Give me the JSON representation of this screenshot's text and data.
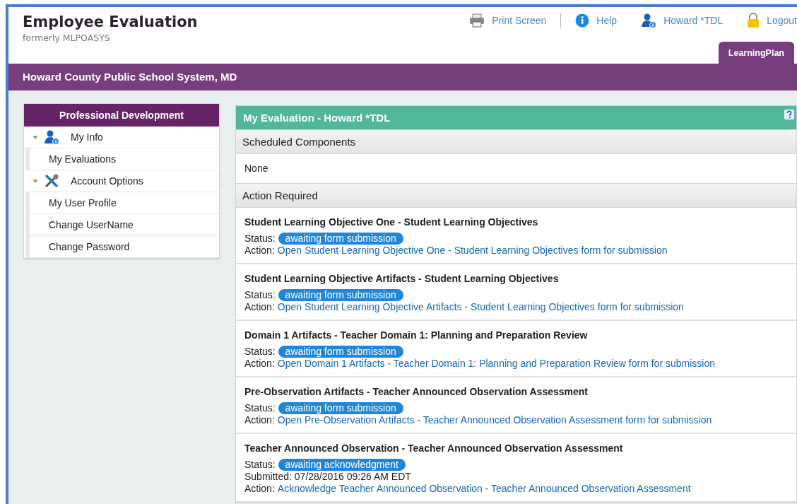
{
  "header": {
    "title": "Employee Evaluation",
    "subtitle": "formerly MLPOASYS"
  },
  "nav": [
    {
      "kind": "print",
      "label": "Print Screen"
    },
    {
      "kind": "help",
      "label": "Help"
    },
    {
      "kind": "user",
      "label": "Howard *TDL"
    },
    {
      "kind": "logout",
      "label": "Logout"
    }
  ],
  "tabs": [
    {
      "label": "LearningPlan",
      "selected": true
    }
  ],
  "org_bar": "Howard County Public School System, MD",
  "sidebar": {
    "title": "Professional Development",
    "groups": [
      {
        "kind": "user",
        "label": "My Info",
        "expanded": true,
        "children": [
          {
            "label": "My Evaluations"
          }
        ]
      },
      {
        "kind": "tools",
        "label": "Account Options",
        "expanded": true,
        "children": [
          {
            "label": "My User Profile"
          },
          {
            "label": "Change UserName"
          },
          {
            "label": "Change Password"
          }
        ]
      }
    ]
  },
  "panel": {
    "title": "My Evaluation - Howard *TDL",
    "sections": [
      {
        "heading": "Scheduled Components",
        "empty_text": "None"
      },
      {
        "heading": "Action Required",
        "items": [
          {
            "title": "Student Learning Objective One - Student Learning Objectives",
            "status_label": "Status:",
            "status": "awaiting form submission",
            "action_label": "Action:",
            "action": "Open Student Learning Objective One - Student Learning Objectives form for submission"
          },
          {
            "title": "Student Learning Objective Artifacts - Student Learning Objectives",
            "status_label": "Status:",
            "status": "awaiting form submission",
            "action_label": "Action:",
            "action": "Open Student Learning Objective Artifacts - Student Learning Objectives form for submission"
          },
          {
            "title": "Domain 1 Artifacts - Teacher Domain 1: Planning and Preparation Review",
            "status_label": "Status:",
            "status": "awaiting form submission",
            "action_label": "Action:",
            "action": "Open Domain 1 Artifacts - Teacher Domain 1: Planning and Preparation Review form for submission"
          },
          {
            "title": "Pre-Observation Artifacts - Teacher Announced Observation Assessment",
            "status_label": "Status:",
            "status": "awaiting form submission",
            "action_label": "Action:",
            "action": "Open Pre-Observation Artifacts - Teacher Announced Observation Assessment form for submission"
          },
          {
            "title": "Teacher Announced Observation - Teacher Announced Observation Assessment",
            "status_label": "Status:",
            "status": "awaiting acknowledgment",
            "submitted": "Submitted: 07/28/2016 09:26 AM EDT",
            "action_label": "Action:",
            "action": "Acknowledge Teacher Announced Observation - Teacher Announced Observation Assessment"
          }
        ]
      }
    ]
  }
}
